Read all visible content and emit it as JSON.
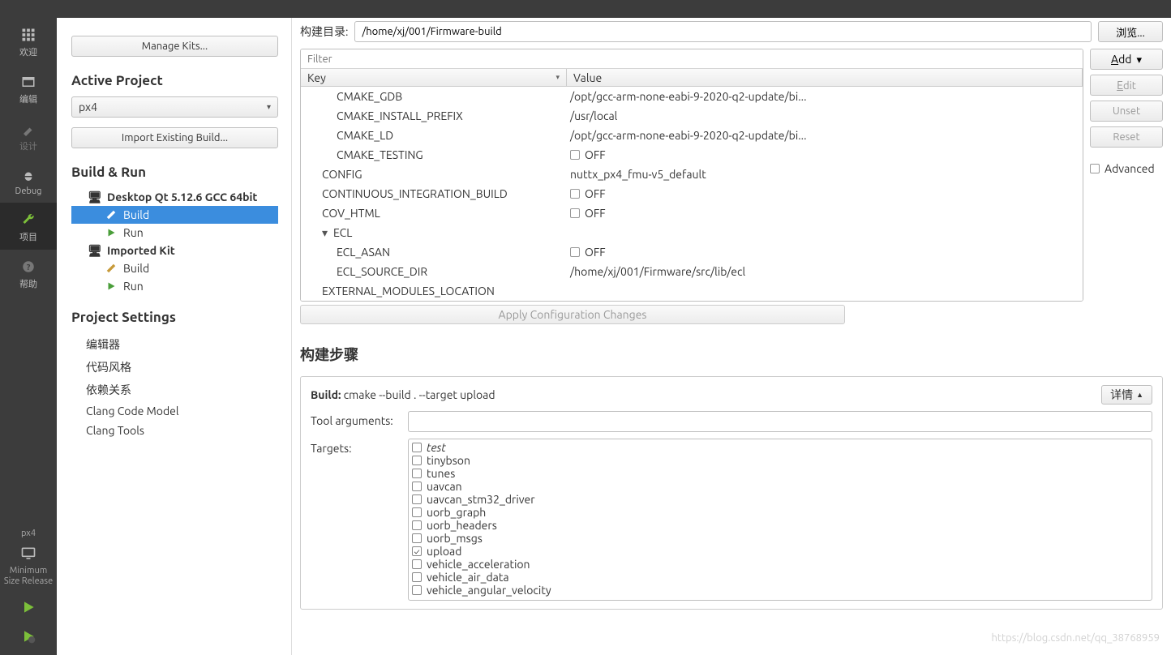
{
  "rail": {
    "welcome": "欢迎",
    "edit": "编辑",
    "design": "设计",
    "debug": "Debug",
    "project": "项目",
    "help": "帮助",
    "context_proj": "px4",
    "context_config": "Minimum\nSize Release"
  },
  "proj": {
    "manage_kits": "Manage Kits...",
    "active_project": "Active Project",
    "project_name": "px4",
    "import_btn": "Import Existing Build...",
    "build_run": "Build & Run",
    "kits": [
      {
        "name": "Desktop Qt 5.12.6 GCC 64bit",
        "children": [
          "Build",
          "Run"
        ],
        "selected_child": "Build"
      },
      {
        "name": "Imported Kit",
        "children": [
          "Build",
          "Run"
        ]
      }
    ],
    "project_settings": "Project Settings",
    "settings": [
      "编辑器",
      "代码风格",
      "依赖关系",
      "Clang Code Model",
      "Clang Tools"
    ]
  },
  "main": {
    "build_dir_label": "构建目录:",
    "build_dir": "/home/xj/001/Firmware-build",
    "browse": "浏览...",
    "filter_placeholder": "Filter",
    "col_key": "Key",
    "col_value": "Value",
    "rows": [
      {
        "k": "CMAKE_GDB",
        "v": "/opt/gcc-arm-none-eabi-9-2020-q2-update/bi...",
        "indent": 2,
        "chk": false
      },
      {
        "k": "CMAKE_INSTALL_PREFIX",
        "v": "/usr/local",
        "indent": 2
      },
      {
        "k": "CMAKE_LD",
        "v": "/opt/gcc-arm-none-eabi-9-2020-q2-update/bi...",
        "indent": 2
      },
      {
        "k": "CMAKE_TESTING",
        "v": "OFF",
        "indent": 2,
        "chk": true
      },
      {
        "k": "CONFIG",
        "v": "nuttx_px4_fmu-v5_default",
        "indent": 1
      },
      {
        "k": "CONTINUOUS_INTEGRATION_BUILD",
        "v": "OFF",
        "indent": 1,
        "chk": true
      },
      {
        "k": "COV_HTML",
        "v": "OFF",
        "indent": 1,
        "chk": true
      },
      {
        "k": "ECL",
        "v": "",
        "indent": 1,
        "expand": true
      },
      {
        "k": "ECL_ASAN",
        "v": "OFF",
        "indent": 2,
        "chk": true
      },
      {
        "k": "ECL_SOURCE_DIR",
        "v": "/home/xj/001/Firmware/src/lib/ecl",
        "indent": 2
      },
      {
        "k": "EXTERNAL_MODULES_LOCATION",
        "v": "",
        "indent": 1
      }
    ],
    "btns": {
      "add": "Add",
      "edit": "Edit",
      "unset": "Unset",
      "reset": "Reset"
    },
    "advanced": "Advanced",
    "apply": "Apply Configuration Changes",
    "steps_title": "构建步骤",
    "step_build_label": "Build:",
    "step_build_cmd": "cmake --build . --target upload",
    "detail": "详情",
    "tool_args_label": "Tool arguments:",
    "tool_args": "",
    "targets_label": "Targets:",
    "targets": [
      {
        "name": "test",
        "checked": false,
        "italic": true
      },
      {
        "name": "tinybson",
        "checked": false
      },
      {
        "name": "tunes",
        "checked": false
      },
      {
        "name": "uavcan",
        "checked": false
      },
      {
        "name": "uavcan_stm32_driver",
        "checked": false
      },
      {
        "name": "uorb_graph",
        "checked": false
      },
      {
        "name": "uorb_headers",
        "checked": false
      },
      {
        "name": "uorb_msgs",
        "checked": false
      },
      {
        "name": "upload",
        "checked": true
      },
      {
        "name": "vehicle_acceleration",
        "checked": false
      },
      {
        "name": "vehicle_air_data",
        "checked": false
      },
      {
        "name": "vehicle_angular_velocity",
        "checked": false
      }
    ]
  },
  "watermark": "https://blog.csdn.net/qq_38768959"
}
